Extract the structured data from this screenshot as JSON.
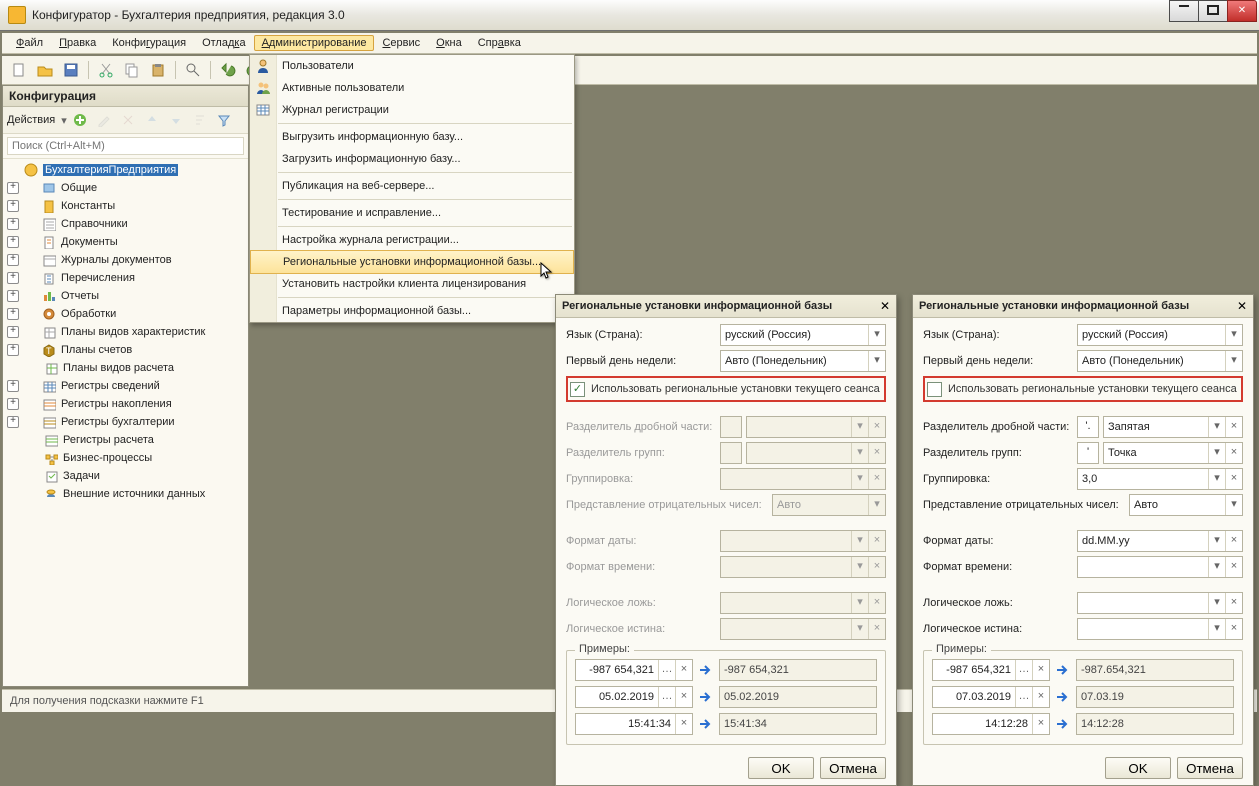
{
  "window": {
    "title": "Конфигуратор - Бухгалтерия предприятия, редакция 3.0"
  },
  "menubar": {
    "file": "Файл",
    "edit": "Правка",
    "config": "Конфигурация",
    "debug": "Отладка",
    "admin": "Администрирование",
    "service": "Сервис",
    "windows": "Окна",
    "help": "Справка"
  },
  "sidebar": {
    "title": "Конфигурация",
    "actions_label": "Действия",
    "search_placeholder": "Поиск (Ctrl+Alt+M)",
    "root_label": "БухгалтерияПредприятия",
    "nodes": [
      "Общие",
      "Константы",
      "Справочники",
      "Документы",
      "Журналы документов",
      "Перечисления",
      "Отчеты",
      "Обработки",
      "Планы видов характеристик",
      "Планы счетов",
      "Планы видов расчета",
      "Регистры сведений",
      "Регистры накопления",
      "Регистры бухгалтерии",
      "Регистры расчета",
      "Бизнес-процессы",
      "Задачи",
      "Внешние источники данных"
    ]
  },
  "statusbar": {
    "text": "Для получения подсказки нажмите F1"
  },
  "admin_menu": {
    "items": [
      "Пользователи",
      "Активные пользователи",
      "Журнал регистрации",
      "Выгрузить информационную базу...",
      "Загрузить информационную базу...",
      "Публикация на веб-сервере...",
      "Тестирование и исправление...",
      "Настройка журнала регистрации...",
      "Региональные установки информационной базы...",
      "Установить настройки клиента лицензирования",
      "Параметры информационной базы..."
    ]
  },
  "dlg": {
    "title": "Региональные установки информационной базы",
    "lang_label": "Язык (Страна):",
    "week_label": "Первый день недели:",
    "use_regional": "Использовать региональные установки текущего сеанса",
    "decsep": "Разделитель дробной части:",
    "grpsep": "Разделитель групп:",
    "grouping": "Группировка:",
    "neg": "Представление отрицательных чисел:",
    "datefmt": "Формат даты:",
    "timefmt": "Формат времени:",
    "boolf": "Логическое ложь:",
    "boolt": "Логическое истина:",
    "examples": "Примеры:",
    "ok": "OK",
    "cancel": "Отмена",
    "left": {
      "lang": "русский (Россия)",
      "week": "Авто (Понедельник)",
      "checked": true,
      "neg_val": "Авто",
      "auto": "Авто",
      "ex_num_in": "-987 654,321",
      "ex_num_out": "-987 654,321",
      "ex_date_in": "05.02.2019",
      "ex_date_out": "05.02.2019",
      "ex_time_in": "15:41:34",
      "ex_time_out": "15:41:34"
    },
    "right": {
      "lang": "русский (Россия)",
      "week": "Авто (Понедельник)",
      "checked": false,
      "dec_char": "'.",
      "dec_name": "Запятая",
      "grp_char": "' ",
      "grp_name": "Точка",
      "grouping_val": "3,0",
      "neg_val": "Авто",
      "datefmt_val": "dd.MM.yy",
      "ex_num_in": "-987 654,321",
      "ex_num_out": "-987.654,321",
      "ex_date_in": "07.03.2019",
      "ex_date_out": "07.03.19",
      "ex_time_in": "14:12:28",
      "ex_time_out": "14:12:28"
    }
  }
}
